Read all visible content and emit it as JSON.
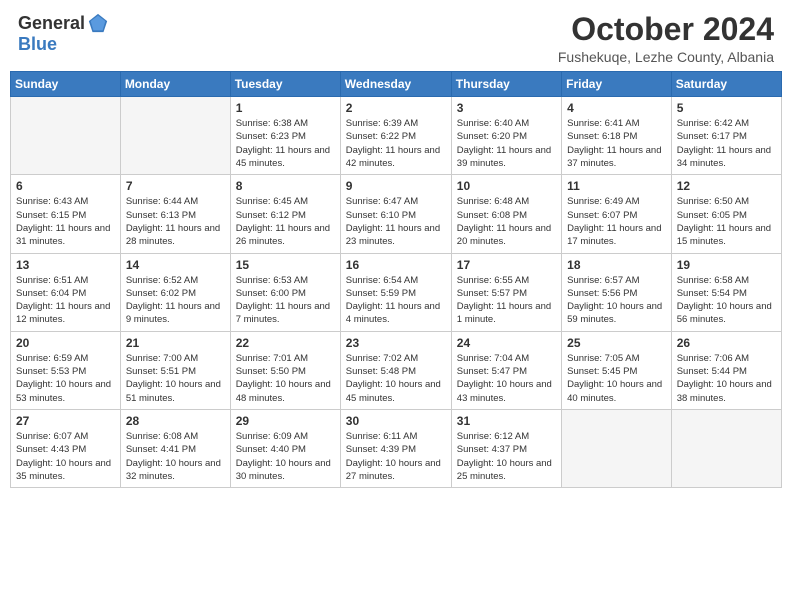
{
  "header": {
    "logo_general": "General",
    "logo_blue": "Blue",
    "month_title": "October 2024",
    "subtitle": "Fushekuqe, Lezhe County, Albania"
  },
  "days_of_week": [
    "Sunday",
    "Monday",
    "Tuesday",
    "Wednesday",
    "Thursday",
    "Friday",
    "Saturday"
  ],
  "weeks": [
    [
      {
        "day": "",
        "info": ""
      },
      {
        "day": "",
        "info": ""
      },
      {
        "day": "1",
        "info": "Sunrise: 6:38 AM\nSunset: 6:23 PM\nDaylight: 11 hours and 45 minutes."
      },
      {
        "day": "2",
        "info": "Sunrise: 6:39 AM\nSunset: 6:22 PM\nDaylight: 11 hours and 42 minutes."
      },
      {
        "day": "3",
        "info": "Sunrise: 6:40 AM\nSunset: 6:20 PM\nDaylight: 11 hours and 39 minutes."
      },
      {
        "day": "4",
        "info": "Sunrise: 6:41 AM\nSunset: 6:18 PM\nDaylight: 11 hours and 37 minutes."
      },
      {
        "day": "5",
        "info": "Sunrise: 6:42 AM\nSunset: 6:17 PM\nDaylight: 11 hours and 34 minutes."
      }
    ],
    [
      {
        "day": "6",
        "info": "Sunrise: 6:43 AM\nSunset: 6:15 PM\nDaylight: 11 hours and 31 minutes."
      },
      {
        "day": "7",
        "info": "Sunrise: 6:44 AM\nSunset: 6:13 PM\nDaylight: 11 hours and 28 minutes."
      },
      {
        "day": "8",
        "info": "Sunrise: 6:45 AM\nSunset: 6:12 PM\nDaylight: 11 hours and 26 minutes."
      },
      {
        "day": "9",
        "info": "Sunrise: 6:47 AM\nSunset: 6:10 PM\nDaylight: 11 hours and 23 minutes."
      },
      {
        "day": "10",
        "info": "Sunrise: 6:48 AM\nSunset: 6:08 PM\nDaylight: 11 hours and 20 minutes."
      },
      {
        "day": "11",
        "info": "Sunrise: 6:49 AM\nSunset: 6:07 PM\nDaylight: 11 hours and 17 minutes."
      },
      {
        "day": "12",
        "info": "Sunrise: 6:50 AM\nSunset: 6:05 PM\nDaylight: 11 hours and 15 minutes."
      }
    ],
    [
      {
        "day": "13",
        "info": "Sunrise: 6:51 AM\nSunset: 6:04 PM\nDaylight: 11 hours and 12 minutes."
      },
      {
        "day": "14",
        "info": "Sunrise: 6:52 AM\nSunset: 6:02 PM\nDaylight: 11 hours and 9 minutes."
      },
      {
        "day": "15",
        "info": "Sunrise: 6:53 AM\nSunset: 6:00 PM\nDaylight: 11 hours and 7 minutes."
      },
      {
        "day": "16",
        "info": "Sunrise: 6:54 AM\nSunset: 5:59 PM\nDaylight: 11 hours and 4 minutes."
      },
      {
        "day": "17",
        "info": "Sunrise: 6:55 AM\nSunset: 5:57 PM\nDaylight: 11 hours and 1 minute."
      },
      {
        "day": "18",
        "info": "Sunrise: 6:57 AM\nSunset: 5:56 PM\nDaylight: 10 hours and 59 minutes."
      },
      {
        "day": "19",
        "info": "Sunrise: 6:58 AM\nSunset: 5:54 PM\nDaylight: 10 hours and 56 minutes."
      }
    ],
    [
      {
        "day": "20",
        "info": "Sunrise: 6:59 AM\nSunset: 5:53 PM\nDaylight: 10 hours and 53 minutes."
      },
      {
        "day": "21",
        "info": "Sunrise: 7:00 AM\nSunset: 5:51 PM\nDaylight: 10 hours and 51 minutes."
      },
      {
        "day": "22",
        "info": "Sunrise: 7:01 AM\nSunset: 5:50 PM\nDaylight: 10 hours and 48 minutes."
      },
      {
        "day": "23",
        "info": "Sunrise: 7:02 AM\nSunset: 5:48 PM\nDaylight: 10 hours and 45 minutes."
      },
      {
        "day": "24",
        "info": "Sunrise: 7:04 AM\nSunset: 5:47 PM\nDaylight: 10 hours and 43 minutes."
      },
      {
        "day": "25",
        "info": "Sunrise: 7:05 AM\nSunset: 5:45 PM\nDaylight: 10 hours and 40 minutes."
      },
      {
        "day": "26",
        "info": "Sunrise: 7:06 AM\nSunset: 5:44 PM\nDaylight: 10 hours and 38 minutes."
      }
    ],
    [
      {
        "day": "27",
        "info": "Sunrise: 6:07 AM\nSunset: 4:43 PM\nDaylight: 10 hours and 35 minutes."
      },
      {
        "day": "28",
        "info": "Sunrise: 6:08 AM\nSunset: 4:41 PM\nDaylight: 10 hours and 32 minutes."
      },
      {
        "day": "29",
        "info": "Sunrise: 6:09 AM\nSunset: 4:40 PM\nDaylight: 10 hours and 30 minutes."
      },
      {
        "day": "30",
        "info": "Sunrise: 6:11 AM\nSunset: 4:39 PM\nDaylight: 10 hours and 27 minutes."
      },
      {
        "day": "31",
        "info": "Sunrise: 6:12 AM\nSunset: 4:37 PM\nDaylight: 10 hours and 25 minutes."
      },
      {
        "day": "",
        "info": ""
      },
      {
        "day": "",
        "info": ""
      }
    ]
  ]
}
